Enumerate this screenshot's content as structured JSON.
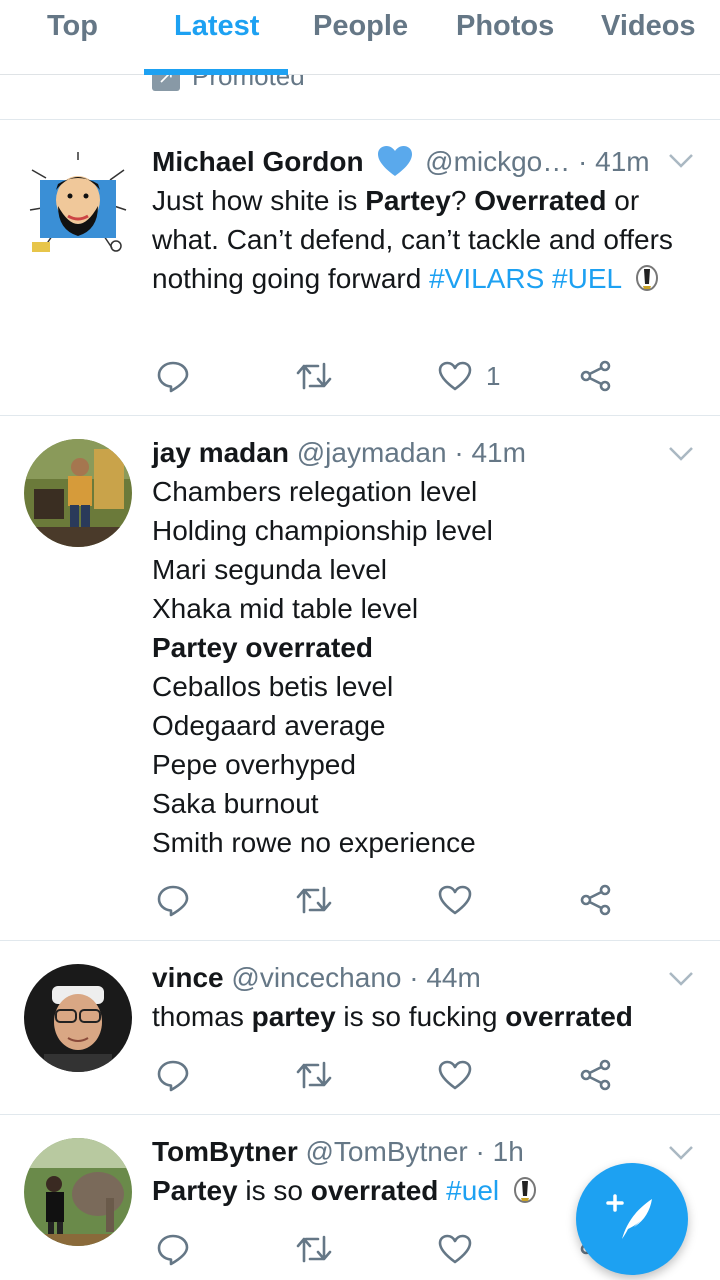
{
  "tabs": [
    {
      "label": "Top",
      "active": false
    },
    {
      "label": "Latest",
      "active": true
    },
    {
      "label": "People",
      "active": false
    },
    {
      "label": "Photos",
      "active": false
    },
    {
      "label": "Videos",
      "active": false
    }
  ],
  "promoted": {
    "label": "Promoted",
    "icon": "promoted-arrow-icon"
  },
  "tweets": [
    {
      "name": "Michael Gordon",
      "verified_emoji": "blue-heart",
      "handle": "@mickgo…",
      "dot": "·",
      "time": "41m",
      "text_parts": [
        {
          "t": "Just how shite is "
        },
        {
          "t": "Partey",
          "bold": true
        },
        {
          "t": "? "
        },
        {
          "t": "Overrated",
          "bold": true
        },
        {
          "t": " or what. Can’t defend, can’t tackle and offers nothing going forward "
        },
        {
          "t": "#VILARS",
          "hashtag": true
        },
        {
          "t": " "
        },
        {
          "t": "#UEL",
          "hashtag": true
        }
      ],
      "likes": "1"
    },
    {
      "name": "jay madan",
      "handle": "@jaymadan",
      "dot": "·",
      "time": "41m",
      "lines": [
        {
          "t": "Chambers relegation level"
        },
        {
          "t": "Holding championship level"
        },
        {
          "t": "Mari segunda level"
        },
        {
          "t": "Xhaka mid table level"
        },
        {
          "t": "Partey overrated",
          "bold": true
        },
        {
          "t": "Ceballos betis level"
        },
        {
          "t": "Odegaard average"
        },
        {
          "t": "Pepe overhyped"
        },
        {
          "t": "Saka burnout"
        },
        {
          "t": "Smith rowe no experience"
        }
      ]
    },
    {
      "name": "vince",
      "handle": "@vincechano",
      "dot": "·",
      "time": "44m",
      "text_parts": [
        {
          "t": "thomas "
        },
        {
          "t": "partey",
          "bold": true
        },
        {
          "t": " is so fucking "
        },
        {
          "t": "overrated",
          "bold": true
        }
      ]
    },
    {
      "name": "TomBytner",
      "handle": "@TomBytner",
      "dot": "·",
      "time": "1h",
      "text_parts": [
        {
          "t": "Partey",
          "bold": true
        },
        {
          "t": " is so "
        },
        {
          "t": "overrated",
          "bold": true
        },
        {
          "t": " "
        },
        {
          "t": "#uel",
          "hashtag": true
        }
      ]
    }
  ],
  "icons": {
    "reply": "reply-icon",
    "retweet": "retweet-icon",
    "like": "heart-icon",
    "share": "share-icon",
    "compose": "compose-tweet-icon"
  },
  "colors": {
    "accent": "#1da1f2",
    "muted": "#657786",
    "text": "#14171a",
    "divider": "#e1e8ed"
  }
}
